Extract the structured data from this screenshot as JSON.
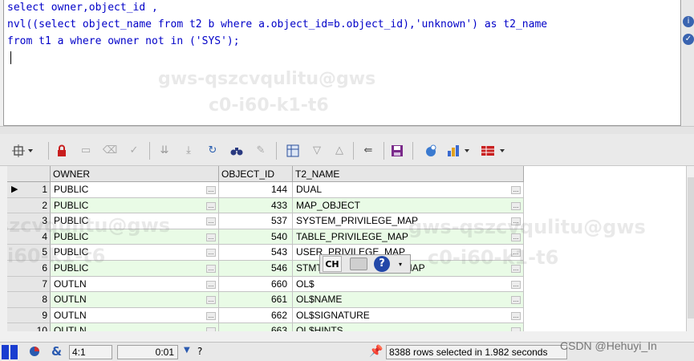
{
  "editor": {
    "lines": [
      "select owner,object_id ,",
      "nvl((select object_name from t2 b where a.object_id=b.object_id),'unknown') as t2_name",
      "from t1 a where owner not in ('SYS');"
    ],
    "watermark_lines": [
      "gws-qszcvqulitu@gws",
      "c0-i60-k1-t6"
    ]
  },
  "grid": {
    "columns": [
      "OWNER",
      "OBJECT_ID",
      "T2_NAME"
    ],
    "rows": [
      {
        "num": "1",
        "owner": "PUBLIC",
        "object_id": "144",
        "t2_name": "DUAL"
      },
      {
        "num": "2",
        "owner": "PUBLIC",
        "object_id": "433",
        "t2_name": "MAP_OBJECT"
      },
      {
        "num": "3",
        "owner": "PUBLIC",
        "object_id": "537",
        "t2_name": "SYSTEM_PRIVILEGE_MAP"
      },
      {
        "num": "4",
        "owner": "PUBLIC",
        "object_id": "540",
        "t2_name": "TABLE_PRIVILEGE_MAP"
      },
      {
        "num": "5",
        "owner": "PUBLIC",
        "object_id": "543",
        "t2_name": "USER_PRIVILEGE_MAP"
      },
      {
        "num": "6",
        "owner": "PUBLIC",
        "object_id": "546",
        "t2_name": "STMT_AUDIT_OPTION_MAP"
      },
      {
        "num": "7",
        "owner": "OUTLN",
        "object_id": "660",
        "t2_name": "OL$"
      },
      {
        "num": "8",
        "owner": "OUTLN",
        "object_id": "661",
        "t2_name": "OL$NAME"
      },
      {
        "num": "9",
        "owner": "OUTLN",
        "object_id": "662",
        "t2_name": "OL$SIGNATURE"
      },
      {
        "num": "10",
        "owner": "OUTLN",
        "object_id": "663",
        "t2_name": "OL$HINTS"
      }
    ],
    "cell_button": "...",
    "watermark_lines": [
      "gws-qszcvqulitu@gws",
      "c0-i60-k1-t6",
      "szcvqulitu@gws",
      "-i60-k1-t6"
    ]
  },
  "ime": {
    "mode": "CH",
    "help": "?"
  },
  "status": {
    "cursor_pos": "4:1",
    "elapsed": "0:01",
    "help_mark": "?",
    "message": "8388 rows selected in 1.982 seconds"
  },
  "footer_watermark": "CSDN @Hehuyi_In",
  "colors": {
    "row_alt": "#e9fbe6",
    "sql_text": "#0000c8",
    "status_blue": "#1a3dd0"
  }
}
